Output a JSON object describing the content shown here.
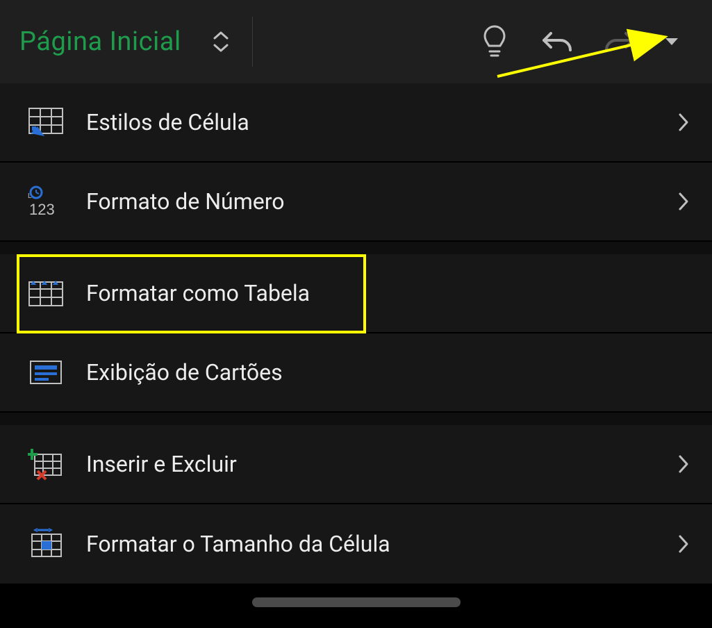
{
  "toolbar": {
    "title": "Página Inicial"
  },
  "menu": {
    "cell_styles": "Estilos de Célula",
    "number_format": "Formato de Número",
    "format_as_table": "Formatar como Tabela",
    "card_view": "Exibição de Cartões",
    "insert_delete": "Inserir e Excluir",
    "cell_size": "Formatar o Tamanho da Célula"
  }
}
